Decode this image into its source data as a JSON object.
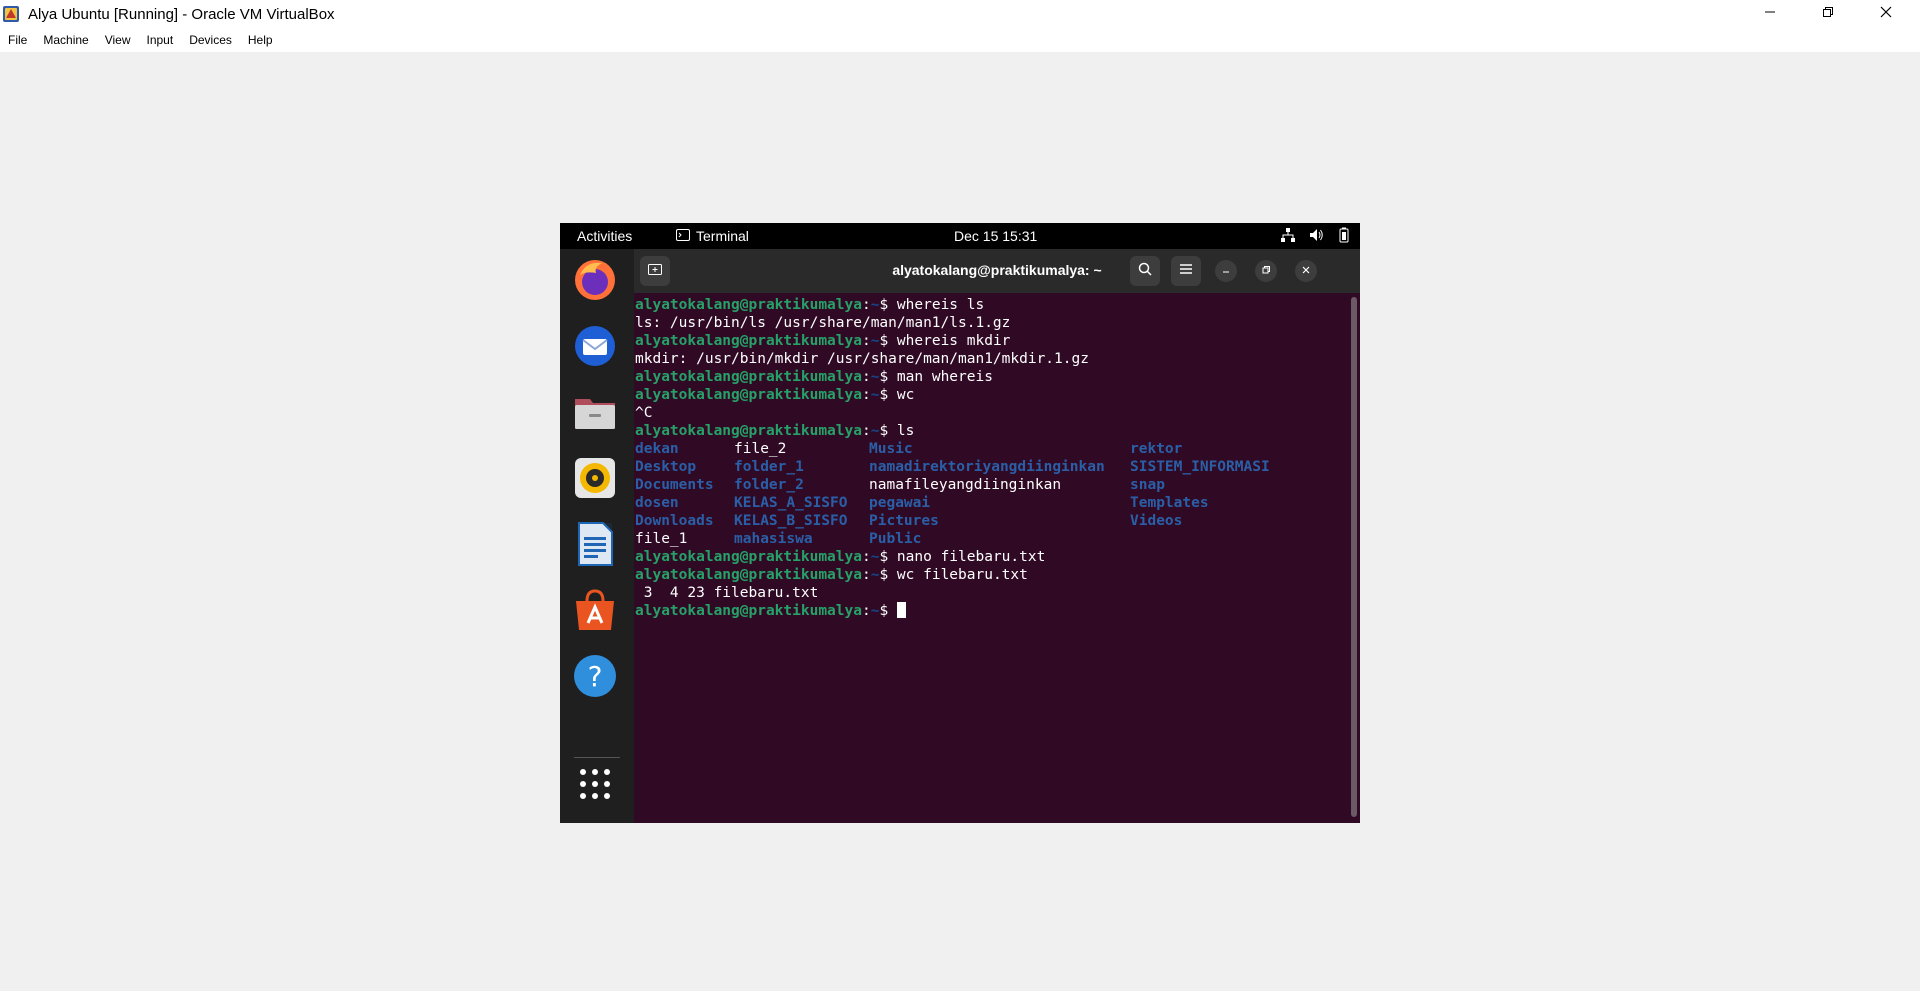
{
  "window": {
    "title": "Alya Ubuntu [Running] - Oracle VM VirtualBox",
    "controls": [
      "minimize-icon",
      "restore-icon",
      "close-icon"
    ]
  },
  "menubar": {
    "items": [
      "File",
      "Machine",
      "View",
      "Input",
      "Devices",
      "Help"
    ]
  },
  "ubuntu_topbar": {
    "activities": "Activities",
    "app_name": "Terminal",
    "datetime": "Dec 15  15:31",
    "status_icons": [
      "network-icon",
      "volume-icon",
      "battery-icon"
    ]
  },
  "dock": {
    "apps": [
      "firefox-icon",
      "thunderbird-icon",
      "files-icon",
      "rhythmbox-icon",
      "libreoffice-writer-icon",
      "app-center-icon",
      "help-icon"
    ],
    "show_apps": "grid-icon"
  },
  "terminal": {
    "title": "alyatokalang@praktikumalya: ~",
    "prompt_user": "alyatokalang@praktikumalya",
    "prompt_path": "~",
    "prompt_colon": ":",
    "prompt_suffix": "$ ",
    "cmd_whereis_ls": "whereis ls",
    "out_whereis_ls": "ls: /usr/bin/ls /usr/share/man/man1/ls.1.gz",
    "cmd_whereis_mkdir": "whereis mkdir",
    "out_whereis_mkdir": "mkdir: /usr/bin/mkdir /usr/share/man/man1/mkdir.1.gz",
    "cmd_man": "man whereis",
    "cmd_wc": "wc",
    "out_ctrl_c": "^C",
    "cmd_ls": "ls",
    "ls_col1": [
      "dekan",
      "Desktop",
      "Documents",
      "dosen",
      "Downloads",
      "file_1"
    ],
    "ls_col2": [
      "file_2",
      "folder_1",
      "folder_2",
      "KELAS_A_SISFO",
      "KELAS_B_SISFO",
      "mahasiswa"
    ],
    "ls_col3": [
      "Music",
      "namadirektoriyangdiinginkan",
      "namafileyangdiinginkan",
      "pegawai",
      "Pictures",
      "Public"
    ],
    "ls_col4": [
      "rektor",
      "SISTEM_INFORMASI",
      "snap",
      "Templates",
      "Videos"
    ],
    "cmd_nano": "nano filebaru.txt",
    "cmd_wc_file": "wc filebaru.txt",
    "out_wc_file": " 3  4 23 filebaru.txt"
  },
  "colors": {
    "terminal_bg": "#300a24",
    "prompt_user": "#26a269",
    "prompt_path": "#12488b",
    "directory": "#2a5fa8",
    "headerbar": "#2a2a2a",
    "dock": "#1f1f1f",
    "ubuntu_topbar": "#000000"
  }
}
